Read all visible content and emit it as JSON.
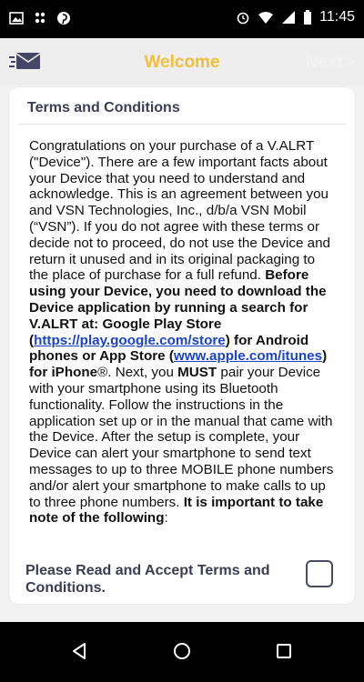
{
  "status_bar": {
    "time": "11:45"
  },
  "header": {
    "title": "Welcome",
    "next_label": "Next",
    "next_chevron": ">"
  },
  "card": {
    "title": "Terms and Conditions"
  },
  "terms": {
    "p1": "Congratulations on your purchase of a V.ALRT (\"Device\"). There are a few important facts about your Device that you need to understand and acknowledge. This is an agreement between you and VSN Technologies, Inc., d/b/a VSN Mobil (“VSN”). If you do not agree with these terms or decide not to proceed, do not use the Device and return it unused and in its original packaging to the place of purchase for a full refund. ",
    "b1": "Before using your Device, you need to download the Device application by running a search for V.ALRT at: Google Play Store (",
    "link1": "https://play.google.com/store",
    "b2": ") for Android phones or App Store (",
    "link2": "www.apple.com/itunes",
    "b3": ") for iPhone",
    "reg": "®",
    "p2a": ". Next, you ",
    "must": "MUST",
    "p2b": " pair your Device with your smartphone using its Bluetooth functionality. Follow the instructions in the application set up or in the manual that came with the Device. After the setup is complete, your Device can alert your smartphone to send text messages to up to three MOBILE phone numbers and/or alert your smartphone to make calls to up to three phone numbers. ",
    "b4": "It is important to take note of the following",
    "colon": ":"
  },
  "accept": {
    "label": "Please Read and Accept Terms and Conditions."
  },
  "icons": {
    "mail": "mail-icon",
    "back": "back-icon",
    "home": "home-icon",
    "recents": "recents-icon"
  },
  "colors": {
    "accent": "#f0c03a",
    "text_dark": "#3c3c55",
    "link": "#1a43c8"
  }
}
